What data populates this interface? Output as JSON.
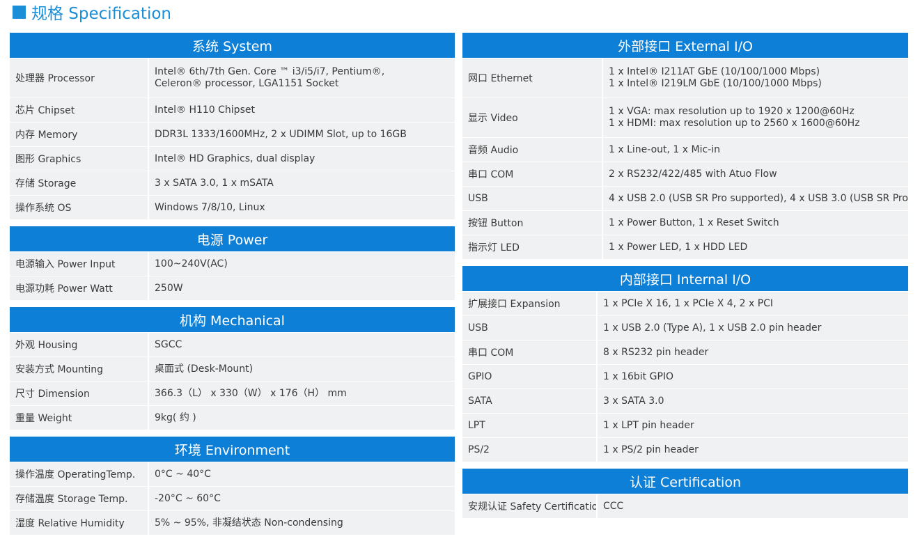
{
  "page_title": "规格 Specification",
  "colors": {
    "accent": "#0e7fd6",
    "title": "#1a8ed6",
    "row_bg": "#f0f1f3"
  },
  "left_sections": [
    {
      "title": "系统 System",
      "rows": [
        {
          "label": "处理器 Processor",
          "value": "Intel® 6th/7th Gen. Core ™ i3/i5/i7, Pentium®, Celeron® processor, LGA1151 Socket"
        },
        {
          "label": "芯片 Chipset",
          "value": "Intel® H110 Chipset"
        },
        {
          "label": "内存 Memory",
          "value": "DDR3L 1333/1600MHz, 2 x UDIMM Slot, up to 16GB"
        },
        {
          "label": "图形 Graphics",
          "value": "Intel® HD Graphics, dual display"
        },
        {
          "label": "存储 Storage",
          "value": "3 x SATA 3.0, 1 x mSATA"
        },
        {
          "label": "操作系统 OS",
          "value": "Windows 7/8/10, Linux"
        }
      ]
    },
    {
      "title": "电源 Power",
      "rows": [
        {
          "label": "电源输入 Power Input",
          "value": "100~240V(AC)"
        },
        {
          "label": "电源功耗 Power Watt",
          "value": "250W"
        }
      ]
    },
    {
      "title": "机构 Mechanical",
      "rows": [
        {
          "label": "外观 Housing",
          "value": "SGCC"
        },
        {
          "label": "安装方式 Mounting",
          "value": "桌面式 (Desk-Mount)"
        },
        {
          "label": "尺寸 Dimension",
          "value": "366.3（L） x 330（W） x 176（H） mm"
        },
        {
          "label": "重量 Weight",
          "value": "9kg( 约 )"
        }
      ]
    },
    {
      "title": "环境 Environment",
      "rows": [
        {
          "label": "操作温度 OperatingTemp.",
          "value": "0°C ~ 40°C"
        },
        {
          "label": "存储温度 Storage Temp.",
          "value": "-20°C ~ 60°C"
        },
        {
          "label": "湿度 Relative Humidity",
          "value": "5% ~ 95%, 非凝结状态 Non-condensing"
        }
      ]
    }
  ],
  "right_sections": [
    {
      "title": "外部接口 External I/O",
      "rows": [
        {
          "label": "网口 Ethernet",
          "value": "1 x Intel® I211AT GbE (10/100/1000 Mbps)",
          "value2": "1 x Intel® I219LM GbE (10/100/1000 Mbps)"
        },
        {
          "label": "显示 Video",
          "value": "1 x VGA: max resolution up to 1920 x 1200@60Hz",
          "value2": "1 x HDMI: max resolution up to 2560 x 1600@60Hz"
        },
        {
          "label": "音频 Audio",
          "value": "1 x Line-out, 1 x Mic-in"
        },
        {
          "label": "串口 COM",
          "value": "2 x RS232/422/485 with Atuo Flow"
        },
        {
          "label": "USB",
          "value": "4 x USB 2.0 (USB SR Pro supported), 4 x USB 3.0 (USB SR Pro"
        },
        {
          "label": "按钮 Button",
          "value": "1 x Power Button, 1 x Reset Switch"
        },
        {
          "label": "指示灯 LED",
          "value": "1 x Power LED, 1 x HDD LED"
        }
      ]
    },
    {
      "title": "内部接口 Internal I/O",
      "rows": [
        {
          "label": "扩展接口 Expansion",
          "value": "1 x PCIe X 16, 1 x PCIe X 4, 2 x PCI"
        },
        {
          "label": "USB",
          "value": "1 x USB 2.0 (Type A), 1 x USB 2.0 pin header"
        },
        {
          "label": "串口 COM",
          "value": "8 x RS232 pin header"
        },
        {
          "label": "GPIO",
          "value": "1 x 16bit GPIO"
        },
        {
          "label": "SATA",
          "value": "3 x SATA 3.0"
        },
        {
          "label": "LPT",
          "value": "1 x LPT pin header"
        },
        {
          "label": "PS/2",
          "value": "1 x PS/2 pin header"
        }
      ]
    },
    {
      "title": "认证 Certification",
      "rows": [
        {
          "label": "安规认证 Safety Certification",
          "value": "CCC"
        }
      ]
    }
  ]
}
